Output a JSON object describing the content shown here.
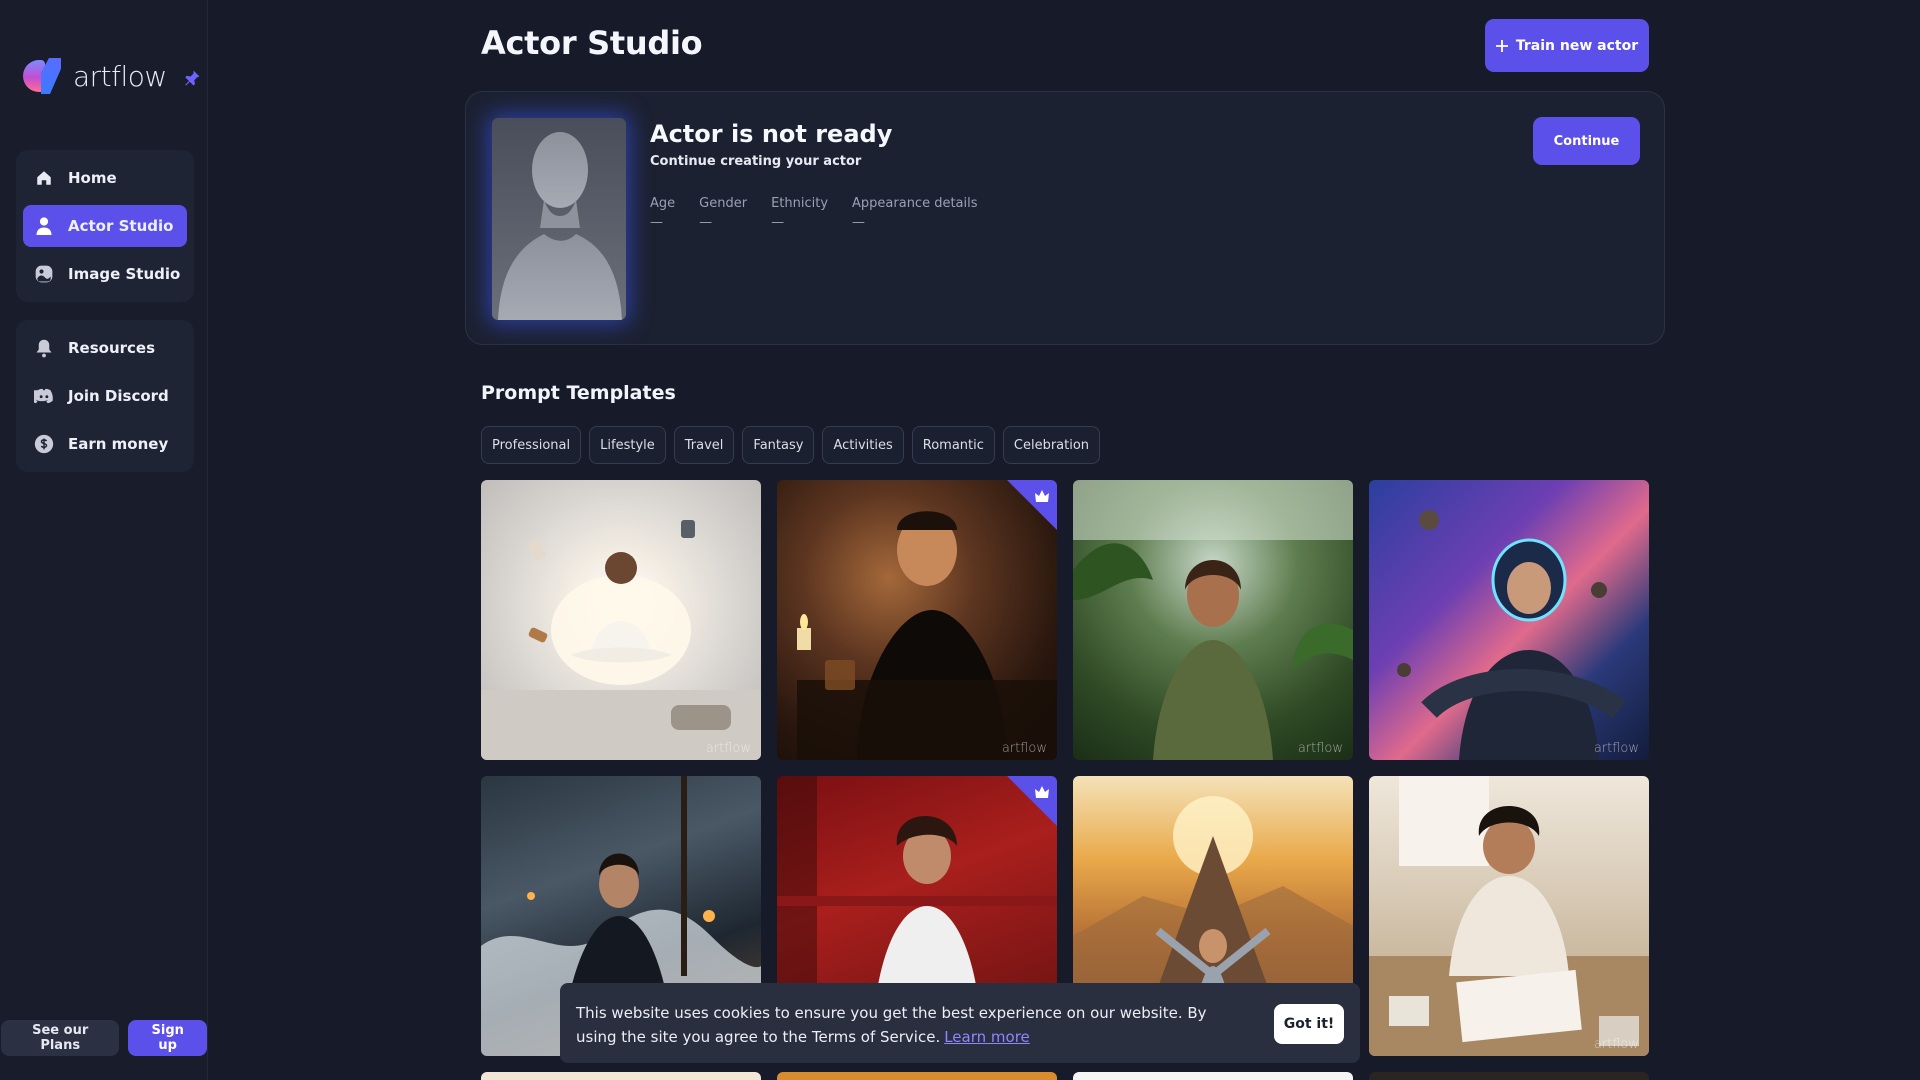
{
  "app": {
    "logo_text": "artflow"
  },
  "sidebar": {
    "nav_primary": [
      {
        "label": "Home",
        "icon": "home-icon",
        "active": false
      },
      {
        "label": "Actor Studio",
        "icon": "person-icon",
        "active": true
      },
      {
        "label": "Image Studio",
        "icon": "image-studio-icon",
        "active": false
      }
    ],
    "nav_secondary": [
      {
        "label": "Resources",
        "icon": "bell-icon"
      },
      {
        "label": "Join Discord",
        "icon": "discord-icon"
      },
      {
        "label": "Earn money",
        "icon": "dollar-icon"
      }
    ],
    "plans_label": "See our Plans",
    "signup_label": "Sign up"
  },
  "header": {
    "title": "Actor Studio",
    "train_button": "Train new actor"
  },
  "actor_card": {
    "status": "Actor is not ready",
    "subtitle": "Continue creating your actor",
    "continue_label": "Continue",
    "attributes": [
      {
        "label": "Age",
        "value": "—"
      },
      {
        "label": "Gender",
        "value": "—"
      },
      {
        "label": "Ethnicity",
        "value": "—"
      },
      {
        "label": "Appearance details",
        "value": "—"
      }
    ]
  },
  "templates": {
    "title": "Prompt Templates",
    "categories": [
      "Professional",
      "Lifestyle",
      "Travel",
      "Fantasy",
      "Activities",
      "Romantic",
      "Celebration"
    ],
    "watermark": "artflow",
    "tiles": [
      {
        "name": "meditation-levitation",
        "premium": false
      },
      {
        "name": "candlelit-man-portrait",
        "premium": true
      },
      {
        "name": "greenhouse-woman",
        "premium": false
      },
      {
        "name": "space-pilot",
        "premium": false
      },
      {
        "name": "pirate-ship-storm",
        "premium": false
      },
      {
        "name": "red-room-woman",
        "premium": true
      },
      {
        "name": "mountain-sunrise",
        "premium": false
      },
      {
        "name": "scrapbook-craft",
        "premium": false
      }
    ]
  },
  "colors": {
    "accent": "#5b50ea",
    "background": "#171b29",
    "card": "#1c2131",
    "link": "#8d86ff"
  },
  "cookie": {
    "text": "This website uses cookies to ensure you get the best experience on our website. By using the site you agree to the Terms of Service.",
    "link_label": "Learn more",
    "button_label": "Got it!"
  }
}
